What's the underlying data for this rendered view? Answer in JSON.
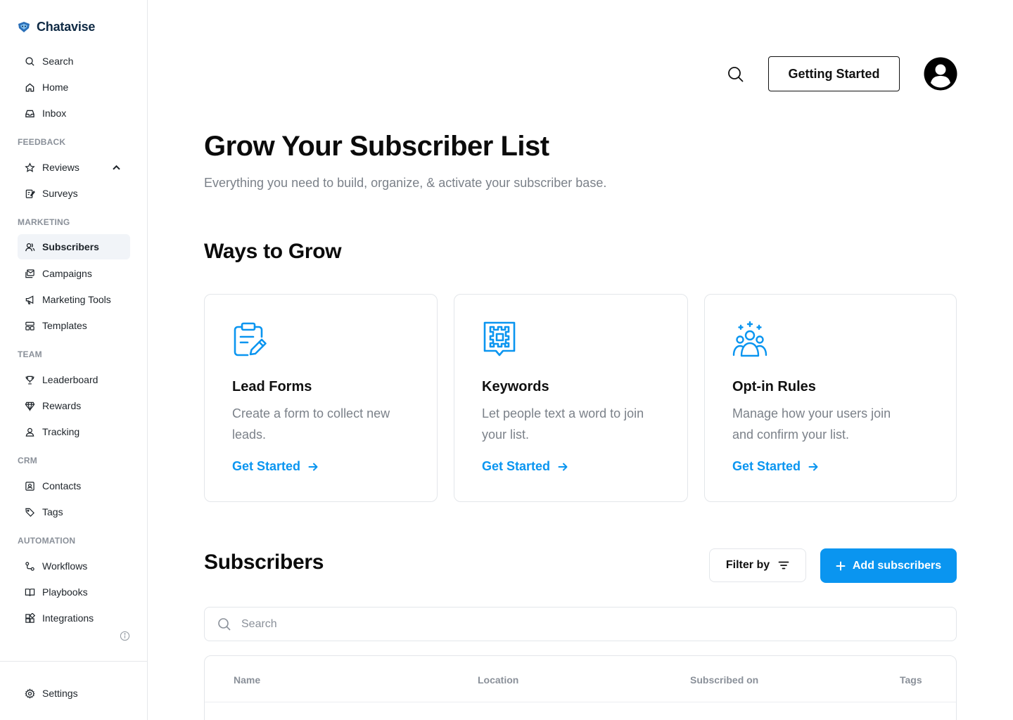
{
  "app": {
    "name": "Chatavise",
    "accent_color": "#0a95f0"
  },
  "sidebar": {
    "top_items": [
      {
        "label": "Search",
        "icon": "search-icon"
      },
      {
        "label": "Home",
        "icon": "home-icon"
      },
      {
        "label": "Inbox",
        "icon": "inbox-icon"
      }
    ],
    "sections": {
      "feedback": "FEEDBACK",
      "marketing": "MARKETING",
      "team": "TEAM",
      "crm": "CRM",
      "automation": "AUTOMATION"
    },
    "feedback_items": [
      {
        "label": "Reviews",
        "icon": "star-icon",
        "expanded": true
      },
      {
        "label": "Surveys",
        "icon": "survey-icon"
      }
    ],
    "marketing_items": [
      {
        "label": "Subscribers",
        "icon": "users-icon",
        "active": true
      },
      {
        "label": "Campaigns",
        "icon": "campaigns-icon"
      },
      {
        "label": "Marketing Tools",
        "icon": "megaphone-icon"
      },
      {
        "label": "Templates",
        "icon": "templates-icon"
      }
    ],
    "team_items": [
      {
        "label": "Leaderboard",
        "icon": "trophy-icon"
      },
      {
        "label": "Rewards",
        "icon": "rewards-icon"
      },
      {
        "label": "Tracking",
        "icon": "tracking-icon"
      }
    ],
    "crm_items": [
      {
        "label": "Contacts",
        "icon": "contacts-icon"
      },
      {
        "label": "Tags",
        "icon": "tag-icon"
      }
    ],
    "automation_items": [
      {
        "label": "Workflows",
        "icon": "workflow-icon"
      },
      {
        "label": "Playbooks",
        "icon": "book-icon"
      },
      {
        "label": "Integrations",
        "icon": "integrations-icon"
      }
    ],
    "settings_label": "Settings"
  },
  "header": {
    "getting_started_label": "Getting Started"
  },
  "main": {
    "title": "Grow Your Subscriber List",
    "subtitle": "Everything you need to build, organize, & activate your subscriber base.",
    "ways_title": "Ways to Grow",
    "cards": [
      {
        "title": "Lead Forms",
        "description": "Create a form to collect new leads.",
        "link": "Get Started",
        "icon": "clipboard-edit-icon"
      },
      {
        "title": "Keywords",
        "description": "Let people text a word to join your list.",
        "link": "Get Started",
        "icon": "keyword-chip-icon"
      },
      {
        "title": "Opt-in Rules",
        "description": "Manage how your users join and confirm your list.",
        "link": "Get Started",
        "icon": "group-plus-icon"
      }
    ],
    "subscribers_title": "Subscribers",
    "filter_label": "Filter by",
    "add_label": "Add subscribers",
    "search_placeholder": "Search",
    "table": {
      "columns": [
        "Name",
        "Location",
        "Subscribed on",
        "Tags"
      ]
    }
  }
}
